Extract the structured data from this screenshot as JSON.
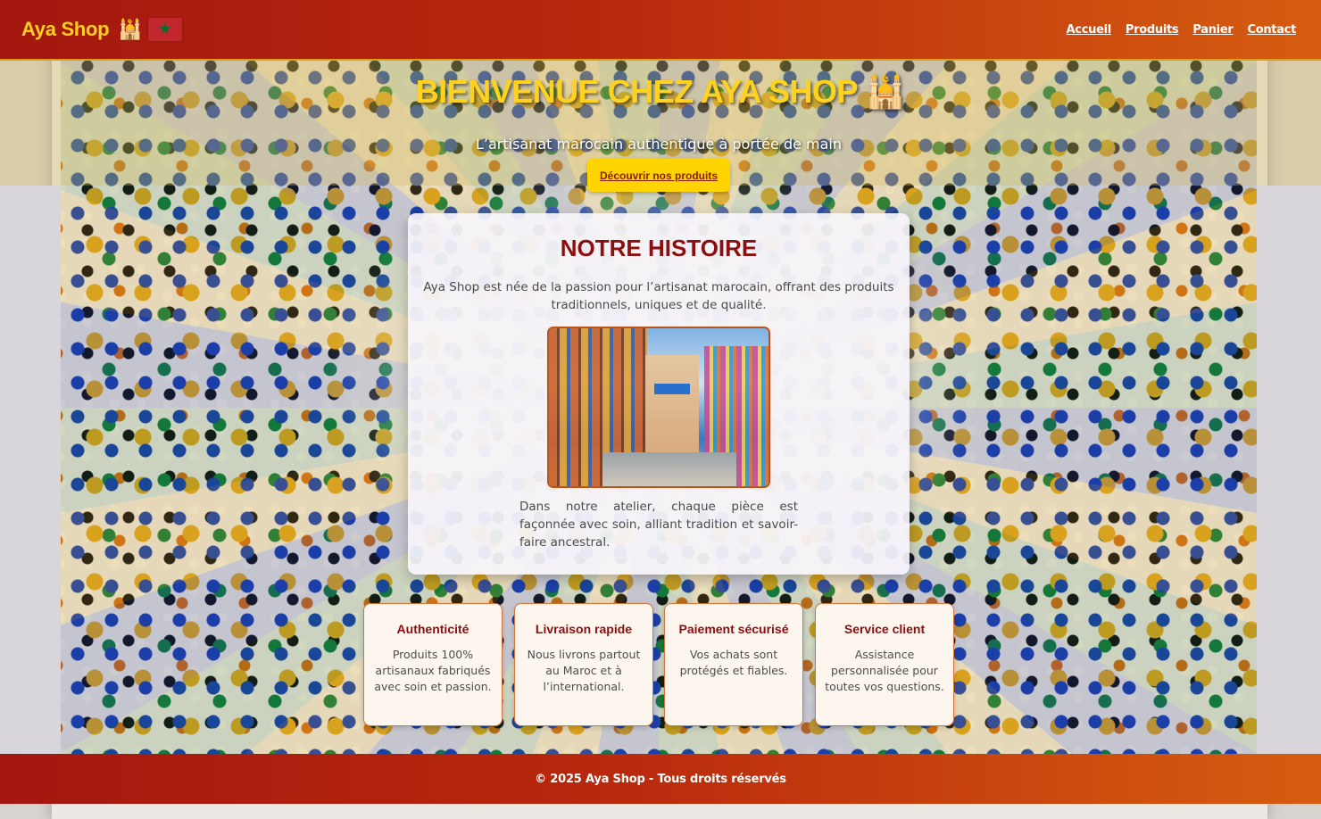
{
  "navbar": {
    "brand": "Aya Shop",
    "brand_mosque": "🕌",
    "links": [
      "Accueil",
      "Produits",
      "Panier",
      "Contact"
    ]
  },
  "hero": {
    "title": "BIENVENUE CHEZ AYA SHOP",
    "title_mosque": "🕌",
    "subtitle": "L’artisanat marocain authentique à portée de main",
    "cta": "Découvrir nos produits"
  },
  "story": {
    "title": "NOTRE HISTOIRE",
    "text1": "Aya Shop est née de la passion pour l’artisanat marocain, offrant des produits traditionnels, uniques et de qualité.",
    "text2": "Dans notre atelier, chaque pièce est façonnée avec soin, alliant tradition et savoir-faire ancestral."
  },
  "features": [
    {
      "title": "Authenticité",
      "text": "Produits 100% artisanaux fabriqués avec soin et passion."
    },
    {
      "title": "Livraison rapide",
      "text": "Nous livrons partout au Maroc et à l’international."
    },
    {
      "title": "Paiement sécurisé",
      "text": "Vos achats sont protégés et fiables."
    },
    {
      "title": "Service client",
      "text": "Assistance personnalisée pour toutes vos questions."
    }
  ],
  "footer": {
    "text": "© 2025 Aya Shop - Tous droits réservés"
  },
  "colors": {
    "header_start": "#a3170f",
    "header_end": "#d65d10",
    "accent_yellow": "#ffd21f",
    "title_red": "#8b0f0f"
  },
  "icons": [
    "mosque-icon",
    "morocco-flag-icon"
  ]
}
